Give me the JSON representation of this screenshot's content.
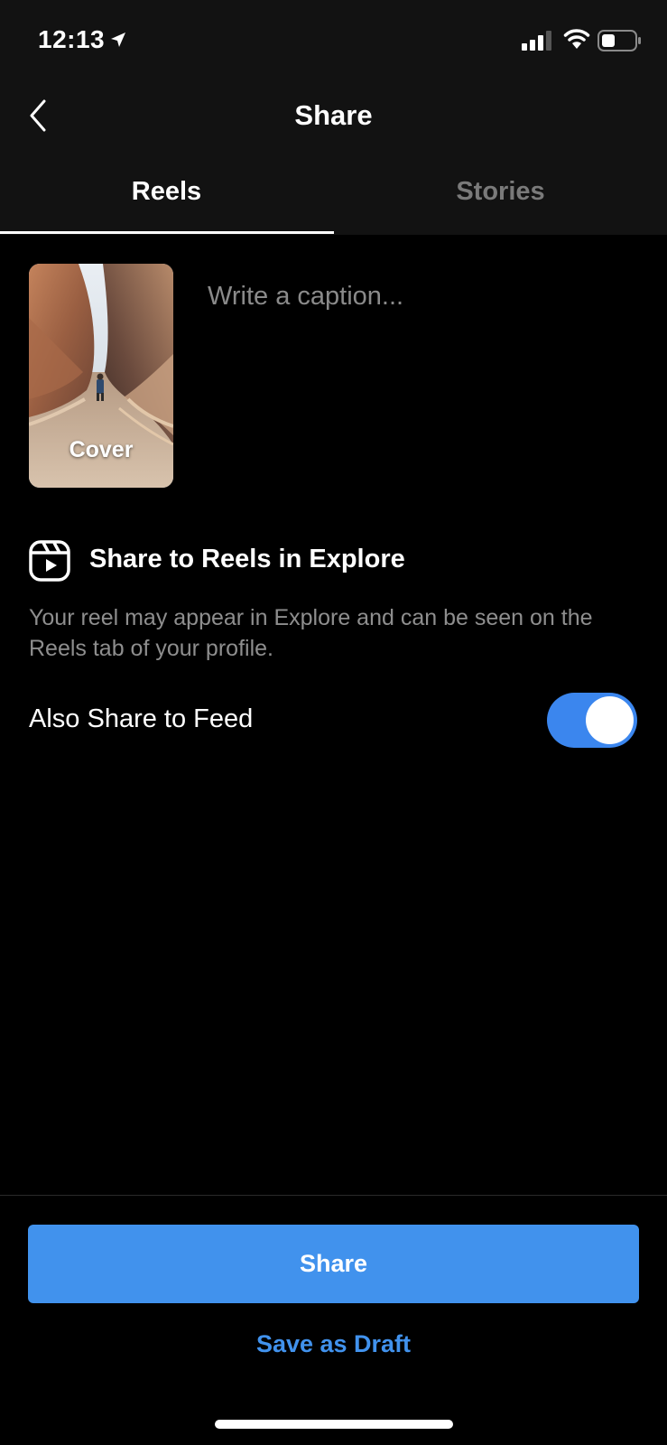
{
  "status_bar": {
    "time": "12:13",
    "icons": [
      "location-arrow-icon",
      "cellular-signal-icon",
      "wifi-icon",
      "battery-icon"
    ]
  },
  "nav": {
    "back_icon": "chevron-left-icon",
    "title": "Share"
  },
  "tabs": [
    {
      "label": "Reels",
      "selected": true
    },
    {
      "label": "Stories",
      "selected": false
    }
  ],
  "cover": {
    "label": "Cover"
  },
  "caption": {
    "placeholder": "Write a caption...",
    "value": ""
  },
  "explore": {
    "icon": "reels-icon",
    "title": "Share to Reels in Explore",
    "description": "Your reel may appear in Explore and can be seen on the Reels tab of your profile."
  },
  "feed_toggle": {
    "label": "Also Share to Feed",
    "enabled": true
  },
  "actions": {
    "share_label": "Share",
    "draft_label": "Save as Draft"
  },
  "colors": {
    "accent": "#4192ed",
    "toggle_on": "#3b86ee",
    "background": "#000000",
    "topbar": "#121212"
  }
}
